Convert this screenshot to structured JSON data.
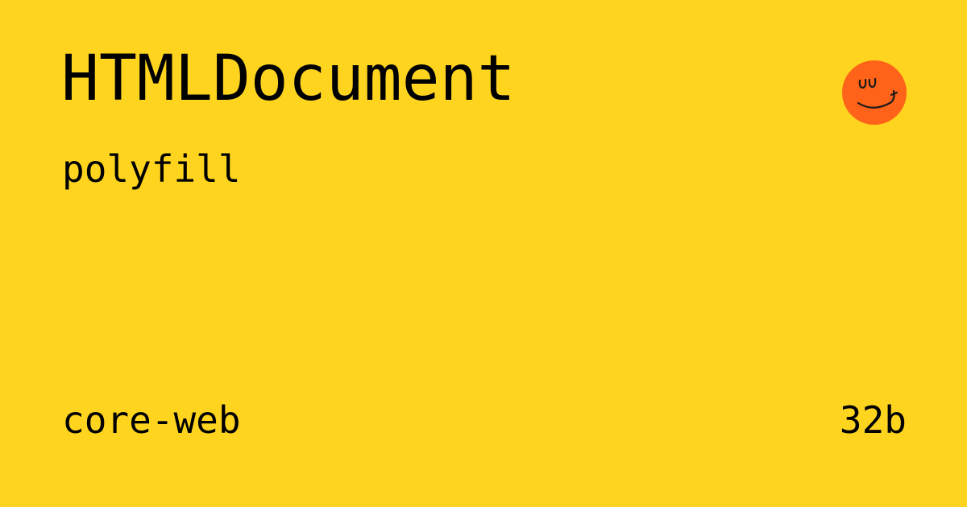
{
  "card": {
    "title": "HTMLDocument",
    "subtitle": "polyfill",
    "package": "core-web",
    "size": "32b",
    "background_color": "#FFD41F",
    "logo": {
      "icon": "smiley-face-icon",
      "color": "#FF6319"
    }
  }
}
